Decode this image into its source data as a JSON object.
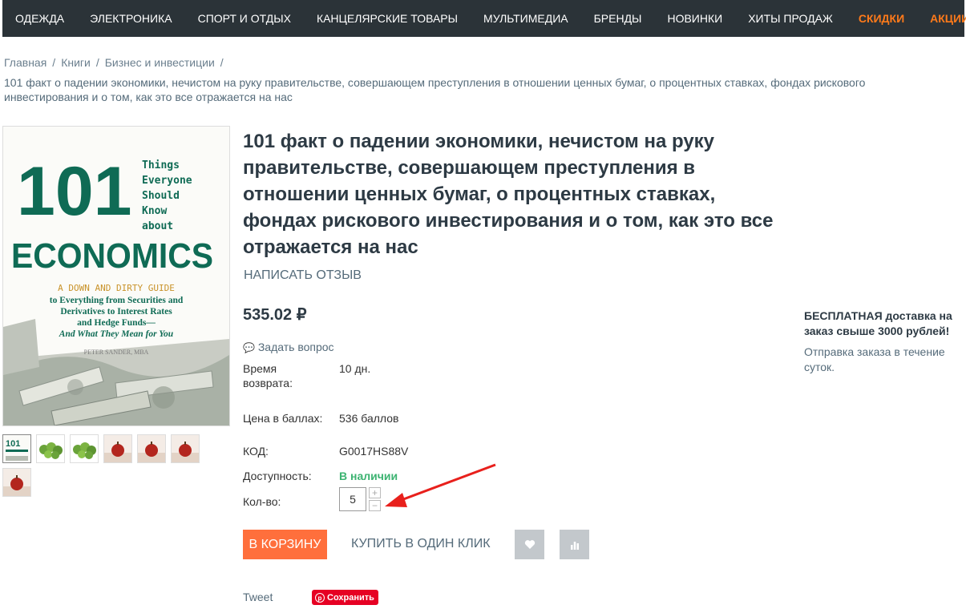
{
  "nav": {
    "items": [
      "ОДЕЖДА",
      "ЭЛЕКТРОНИКА",
      "СПОРТ И ОТДЫХ",
      "КАНЦЕЛЯРСКИЕ ТОВАРЫ",
      "МУЛЬТИМЕДИА",
      "БРЕНДЫ",
      "НОВИНКИ",
      "ХИТЫ ПРОДАЖ",
      "СКИДКИ",
      "АКЦИИ"
    ],
    "accent_color": "#ff7a1a"
  },
  "breadcrumb": {
    "items": [
      "Главная",
      "Книги",
      "Бизнес и инвестиции"
    ],
    "separator": "/",
    "current": "101 факт о падении экономики, нечистом на руку правительстве, совершающем преступления в отношении ценных бумаг, о процентных ставках, фондах рискового инвестирования и о том, как это все отражается на нас"
  },
  "cover": {
    "big_number": "101",
    "small_text": [
      "Things",
      "Everyone",
      "Should",
      "Know",
      "about"
    ],
    "word": "ECONOMICS",
    "guide_line": "A DOWN AND DIRTY GUIDE",
    "sub_lines": [
      "to Everything from Securities and",
      "Derivatives to Interest Rates",
      "and Hedge Funds—",
      "And What They Mean for You"
    ],
    "author": "PETER SANDER, MBA"
  },
  "thumbnails": [
    "book-cover",
    "green-veg",
    "green-veg",
    "apple",
    "apple",
    "apple",
    "apple"
  ],
  "product": {
    "title": "101 факт о падении экономики, нечистом на руку правительстве, совершающем преступления в отношении ценных бумаг, о процентных ставках, фондах рискового инвестирования и о том, как это все отражается на нас",
    "review_link": "НАПИСАТЬ ОТЗЫВ",
    "price": "535.02 ₽",
    "ask_question": "Задать вопрос",
    "return_label": "Время возврата:",
    "return_value": "10 дн.",
    "points_label": "Цена в баллах:",
    "points_value": "536 баллов",
    "code_label": "КОД:",
    "code_value": "G0017HS88V",
    "availability_label": "Доступность:",
    "availability_value": "В наличии",
    "qty_label": "Кол-во:",
    "qty_value": "5",
    "plus": "+",
    "minus": "−",
    "cart_button": "В КОРЗИНУ",
    "one_click": "КУПИТЬ В ОДИН КЛИК",
    "tweet": "Tweet",
    "pin_save": "Сохранить"
  },
  "delivery": {
    "title": "БЕСПЛАТНАЯ доставка на заказ свыше 3000 рублей!",
    "text": "Отправка заказа в течение суток."
  },
  "colors": {
    "nav_bg": "#2b3338",
    "cart_button": "#ff6f3c",
    "in_stock": "#3cb371",
    "pinterest": "#e60023",
    "cover_green": "#0f6b55"
  }
}
